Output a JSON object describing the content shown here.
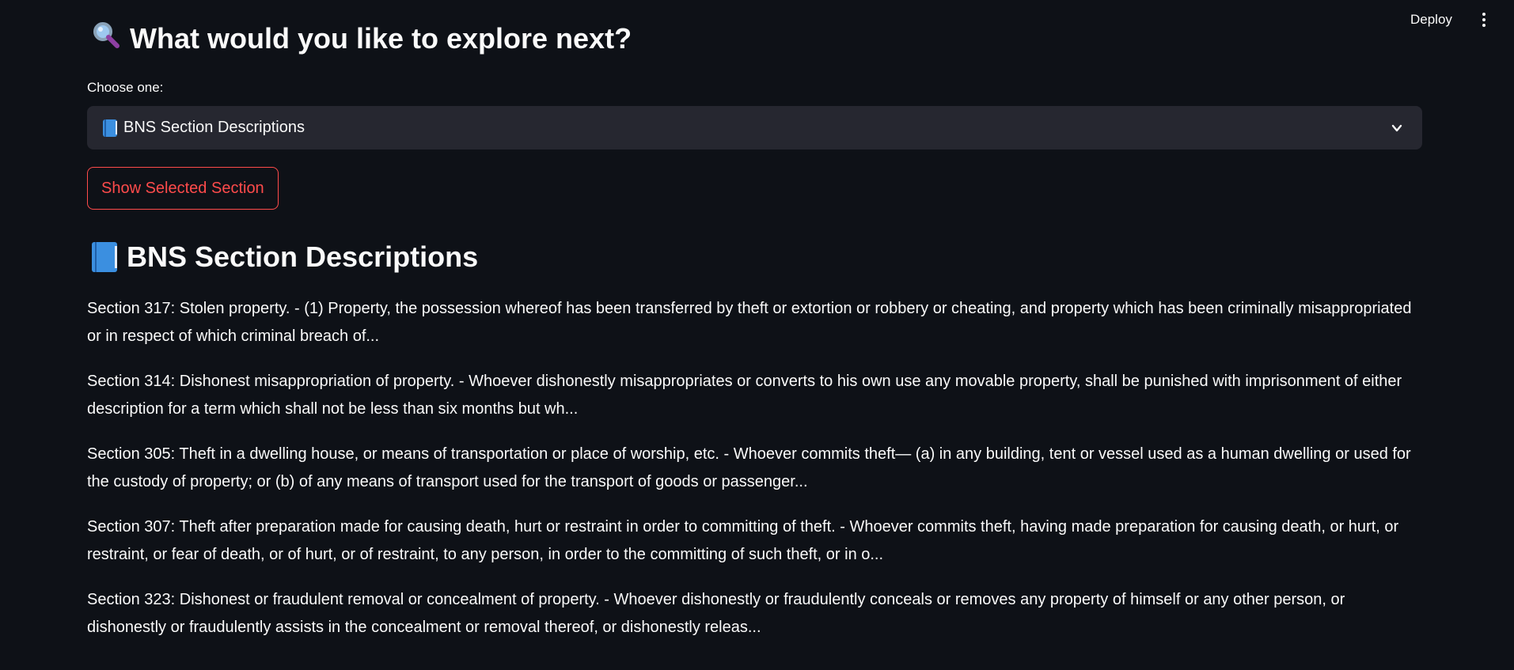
{
  "header": {
    "deploy_label": "Deploy",
    "menu_icon": "vertical-ellipsis-icon"
  },
  "explore": {
    "icon": "magnifying-glass-icon",
    "title": "What would you like to explore next?"
  },
  "select": {
    "label": "Choose one:",
    "value_icon": "blue-book-icon",
    "value": "BNS Section Descriptions"
  },
  "show_button_label": "Show Selected Section",
  "section": {
    "icon": "blue-book-icon",
    "title": "BNS Section Descriptions",
    "items": [
      "Section 317: Stolen property. - (1) Property, the possession whereof has been transferred by theft or extortion or robbery or cheating, and property which has been criminally misappropriated or in respect of which criminal breach of...",
      "Section 314: Dishonest misappropriation of property. - Whoever dishonestly misappropriates or converts to his own use any movable property, shall be punished with imprisonment of either description for a term which shall not be less than six months but wh...",
      "Section 305: Theft in a dwelling house, or means of transportation or place of worship, etc. - Whoever commits theft— (a) in any building, tent or vessel used as a human dwelling or used for the custody of property; or (b) of any means of transport used for the transport of goods or passenger...",
      "Section 307: Theft after preparation made for causing death, hurt or restraint in order to committing of theft. - Whoever commits theft, having made preparation for causing death, or hurt, or restraint, or fear of death, or of hurt, or of restraint, to any person, in order to the committing of such theft, or in o...",
      "Section 323: Dishonest or fraudulent removal or concealment of property. - Whoever dishonestly or fraudulently conceals or removes any property of himself or any other person, or dishonestly or fraudulently assists in the concealment or removal thereof, or dishonestly releas..."
    ]
  },
  "colors": {
    "background": "#0e1117",
    "select_bg": "#262730",
    "accent": "#ff4b4b",
    "text": "#fafafa"
  }
}
